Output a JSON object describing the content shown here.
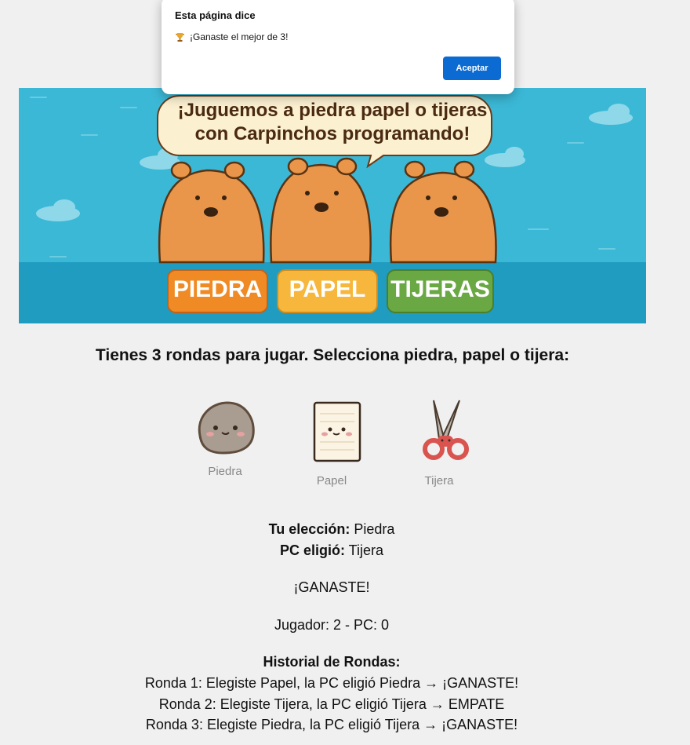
{
  "dialog": {
    "title": "Esta página dice",
    "message": "¡Ganaste el mejor de 3!",
    "icon": "trophy-icon",
    "button_label": "Aceptar"
  },
  "banner": {
    "title_line1": "¡Juguemos a piedra papel o tijeras",
    "title_line2": "con Carpinchos programando!",
    "buttons": [
      "PIEDRA",
      "PAPEL",
      "TIJERAS"
    ]
  },
  "instructions": "Tienes 3 rondas para jugar. Selecciona piedra, papel o tijera:",
  "choices": [
    {
      "label": "Piedra",
      "icon": "rock-icon"
    },
    {
      "label": "Papel",
      "icon": "paper-icon"
    },
    {
      "label": "Tijera",
      "icon": "scissors-icon"
    }
  ],
  "result": {
    "your_choice_label": "Tu elección:",
    "your_choice_value": "Piedra",
    "pc_choice_label": "PC eligió:",
    "pc_choice_value": "Tijera",
    "outcome": "¡GANASTE!",
    "score": "Jugador: 2 - PC: 0"
  },
  "history": {
    "title": "Historial de Rondas:",
    "rounds": [
      "Ronda 1: Elegiste Papel, la PC eligió Piedra → ¡GANASTE!",
      "Ronda 2: Elegiste Tijera, la PC eligió Tijera → EMPATE",
      "Ronda 3: Elegiste Piedra, la PC eligió Tijera → ¡GANASTE!"
    ]
  },
  "colors": {
    "sky": "#3bb8d6",
    "water": "#1f9cc0",
    "capybara": "#e9964a",
    "piedra_btn": "#f08a24",
    "papel_btn": "#f6b73c",
    "tijeras_btn": "#6aa844",
    "dialog_button": "#0b6bd3"
  }
}
